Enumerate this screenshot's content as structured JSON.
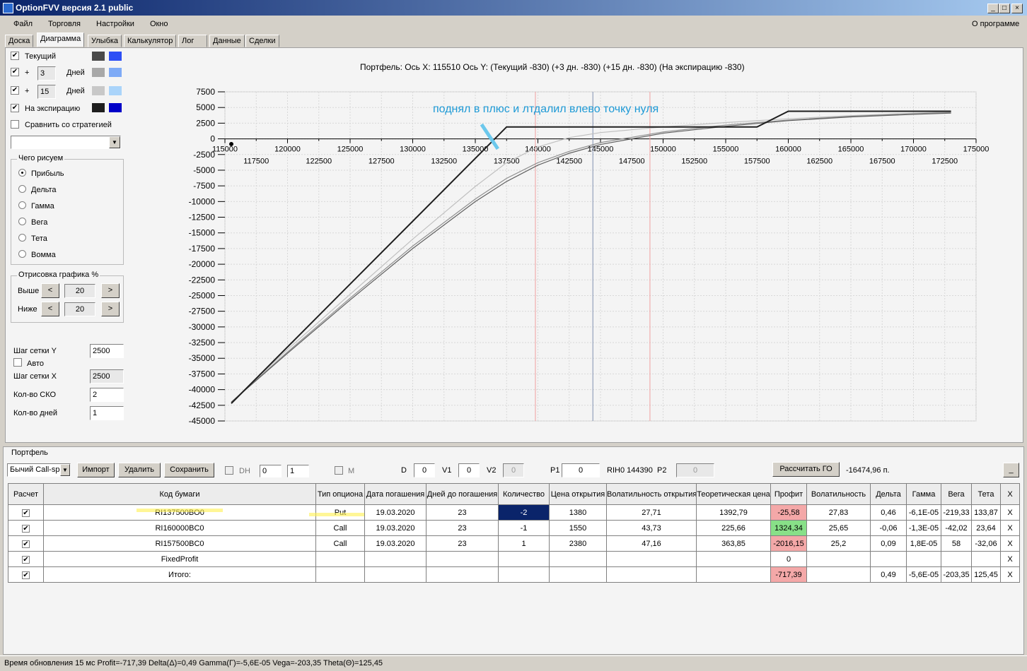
{
  "window": {
    "title": "OptionFVV версия 2.1 public"
  },
  "menu": {
    "items": [
      "Файл",
      "Торговля",
      "Настройки",
      "Окно"
    ],
    "about": "О программе"
  },
  "tabs": [
    "Доска",
    "Диаграмма",
    "Улыбка",
    "Калькулятор",
    "Лог",
    "Данные",
    "Сделки"
  ],
  "left_panel": {
    "rows": [
      {
        "label": "Текущий",
        "checked": true,
        "colors": [
          "#4a4a4a",
          "#2d4ff5"
        ]
      },
      {
        "prefix": "+",
        "days": "3",
        "label": "Дней",
        "checked": true,
        "colors": [
          "#a8a8a8",
          "#7eaaf6"
        ]
      },
      {
        "prefix": "+",
        "days": "15",
        "label": "Дней",
        "checked": true,
        "colors": [
          "#c8c8c8",
          "#aad4fa"
        ]
      },
      {
        "label": "На экспирацию",
        "checked": true,
        "colors": [
          "#1e1e1e",
          "#0000c8"
        ]
      }
    ],
    "compare_label": "Сравнить со стратегией",
    "what_group": "Чего рисуем",
    "radio": [
      "Прибыль",
      "Дельта",
      "Гамма",
      "Вега",
      "Тета",
      "Вомма"
    ],
    "draw_group": "Отрисовка графика %",
    "above_label": "Выше",
    "above_value": "20",
    "below_label": "Ниже",
    "below_value": "20",
    "grid_y_label": "Шаг сетки Y",
    "grid_y": "2500",
    "auto_label": "Авто",
    "grid_x_label": "Шаг сетки X",
    "grid_x": "2500",
    "sko_label": "Кол-во СКО",
    "sko": "2",
    "days_label": "Кол-во дней",
    "days": "1",
    "prev": "<",
    "next": ">"
  },
  "chart_data": {
    "type": "line",
    "title": "Портфель: Ось X: 115510 Ось Y:  (Текущий -830)  (+3 дн. -830)  (+15 дн. -830)  (На экспирацию -830)",
    "annotation": "поднял в плюс и лтдалил влево точку нуля",
    "xlim": [
      115000,
      175000
    ],
    "ylim": [
      -45000,
      7500
    ],
    "x_ticks_top": [
      115000,
      120000,
      125000,
      130000,
      135000,
      140000,
      145000,
      150000,
      155000,
      160000,
      165000,
      170000,
      175000
    ],
    "x_ticks_bottom": [
      117500,
      122500,
      127500,
      132500,
      137500,
      142500,
      147500,
      152500,
      157500,
      162500,
      167500,
      172500
    ],
    "y_ticks": [
      7500,
      5000,
      2500,
      0,
      -2500,
      -5000,
      -7500,
      -10000,
      -12500,
      -15000,
      -17500,
      -20000,
      -22500,
      -25000,
      -27500,
      -30000,
      -32500,
      -35000,
      -37500,
      -40000,
      -42500,
      -45000
    ],
    "grid": true,
    "vlines": [
      {
        "x": 139800,
        "color": "#f0a0a0"
      },
      {
        "x": 144390,
        "color": "#8090b0"
      },
      {
        "x": 148950,
        "color": "#f0a0a0"
      }
    ],
    "series": [
      {
        "name": "На экспирацию",
        "color": "#1e1e1e",
        "x": [
          115510,
          137500,
          157500,
          160000,
          173000
        ],
        "y": [
          -42200,
          1900,
          1900,
          4400,
          4400
        ]
      },
      {
        "name": "Текущий",
        "color": "#606060",
        "x": [
          115510,
          120000,
          125000,
          130000,
          135000,
          137500,
          140000,
          142500,
          145000,
          150000,
          155000,
          160000,
          165000,
          170000,
          173000
        ],
        "y": [
          -42000,
          -34200,
          -25700,
          -17500,
          -10000,
          -6800,
          -4200,
          -2300,
          -900,
          900,
          2000,
          2900,
          3500,
          3900,
          4100
        ]
      },
      {
        "name": "+3 дн.",
        "color": "#909090",
        "x": [
          115510,
          120000,
          125000,
          130000,
          135000,
          137500,
          140000,
          142500,
          145000,
          150000,
          155000,
          160000,
          165000,
          170000,
          173000
        ],
        "y": [
          -42000,
          -34000,
          -25400,
          -17100,
          -9600,
          -6300,
          -3800,
          -2000,
          -600,
          1100,
          2200,
          3000,
          3600,
          4000,
          4200
        ]
      },
      {
        "name": "+15 дн.",
        "color": "#c0c0c0",
        "x": [
          115510,
          120000,
          125000,
          130000,
          135000,
          137500,
          140000,
          142500,
          145000,
          150000,
          155000,
          160000,
          165000,
          170000,
          173000
        ],
        "y": [
          -42000,
          -33600,
          -24800,
          -16000,
          -7600,
          -3800,
          -1300,
          200,
          1000,
          1900,
          2600,
          3200,
          3700,
          4100,
          4300
        ]
      }
    ]
  },
  "portfolio": {
    "group": "Портфель",
    "strategy": "Бычий Call-spr",
    "import": "Импорт",
    "delete": "Удалить",
    "save": "Сохранить",
    "dh": "DH",
    "spin1": "0",
    "spin2": "1",
    "m": "M",
    "d_label": "D",
    "d": "0",
    "v1_label": "V1",
    "v1": "0",
    "v2_label": "V2",
    "v2": "0",
    "p1_label": "P1",
    "p1": "0",
    "rih": "RIH0 144390",
    "p2_label": "P2",
    "p2": "0",
    "calc_go": "Рассчитать ГО",
    "go_value": "-16474,96 п.",
    "minimize": "_"
  },
  "table": {
    "headers": [
      "Расчет",
      "Код бумаги",
      "Тип опциона",
      "Дата погашения",
      "Дней до погашения",
      "Количество",
      "Цена открытия",
      "Волатильность открытия",
      "Теоретическая цена",
      "Профит",
      "Волатильность",
      "Дельта",
      "Гамма",
      "Вега",
      "Тета",
      "X"
    ],
    "rows": [
      [
        "RI137500BO0",
        "Put",
        "19.03.2020",
        "23",
        "-2",
        "1380",
        "27,71",
        "1392,79",
        "-25,58",
        "27,83",
        "0,46",
        "-6,1E-05",
        "-219,33",
        "133,87"
      ],
      [
        "RI160000BC0",
        "Call",
        "19.03.2020",
        "23",
        "-1",
        "1550",
        "43,73",
        "225,66",
        "1324,34",
        "25,65",
        "-0,06",
        "-1,3E-05",
        "-42,02",
        "23,64"
      ],
      [
        "RI157500BC0",
        "Call",
        "19.03.2020",
        "23",
        "1",
        "2380",
        "47,16",
        "363,85",
        "-2016,15",
        "25,2",
        "0,09",
        "1,8E-05",
        "58",
        "-32,06"
      ],
      [
        "FixedProfit",
        "",
        "",
        "",
        "",
        "",
        "",
        "",
        "0",
        "",
        "",
        "",
        "",
        ""
      ],
      [
        "Итого:",
        "",
        "",
        "",
        "",
        "",
        "",
        "",
        "-717,39",
        "",
        "0,49",
        "-5,6E-05",
        "-203,35",
        "125,45"
      ]
    ],
    "profit_colors": [
      "#f4a8a8",
      "#88e088",
      "#f4a8a8",
      "#ffffff",
      "#f4a8a8"
    ],
    "delete_label": "X"
  },
  "status": "Время обновления 15 мс  Profit=-717,39 Delta(Δ)=0,49 Gamma(Г)=-5,6E-05 Vega=-203,35 Theta(Θ)=125,45"
}
